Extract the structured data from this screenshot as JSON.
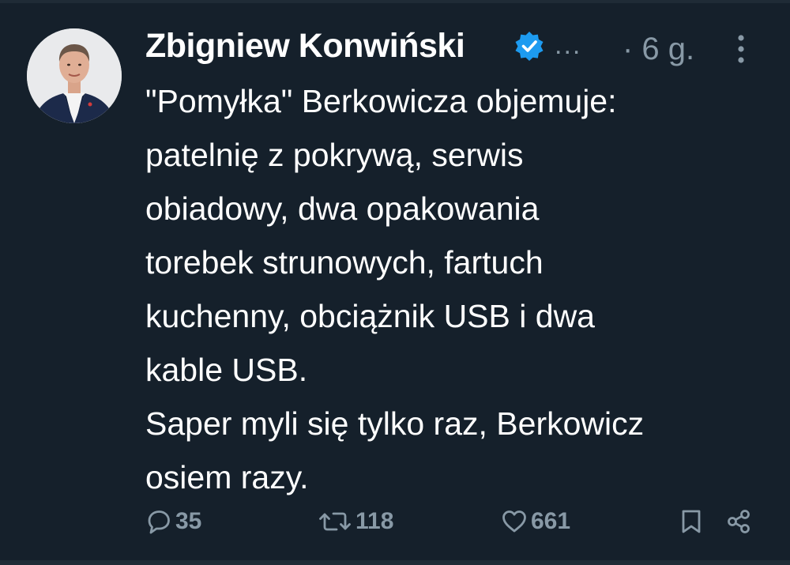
{
  "author": {
    "name": "Zbigniew Konwiński",
    "handle_truncated": "...",
    "time": "· 6 g."
  },
  "tweet": {
    "lines": [
      "\"Pomyłka\" Berkowicza objemuje:",
      "patelnię z pokrywą, serwis",
      "obiadowy, dwa opakowania",
      "torebek strunowych, fartuch",
      "kuchenny, obciążnik USB i dwa",
      "kable USB.",
      "Saper myli się tylko raz, Berkowicz",
      "osiem razy."
    ]
  },
  "actions": {
    "replies": "35",
    "retweets": "118",
    "likes": "661"
  },
  "icons": {
    "verified": "verified-badge-icon",
    "more": "more-vertical-icon",
    "reply": "reply-icon",
    "retweet": "retweet-icon",
    "like": "heart-icon",
    "bookmark": "bookmark-icon",
    "share": "share-icon"
  },
  "colors": {
    "background": "#15202b",
    "text": "#ffffff",
    "secondary": "#8899a6",
    "verified": "#1d9bf0"
  }
}
